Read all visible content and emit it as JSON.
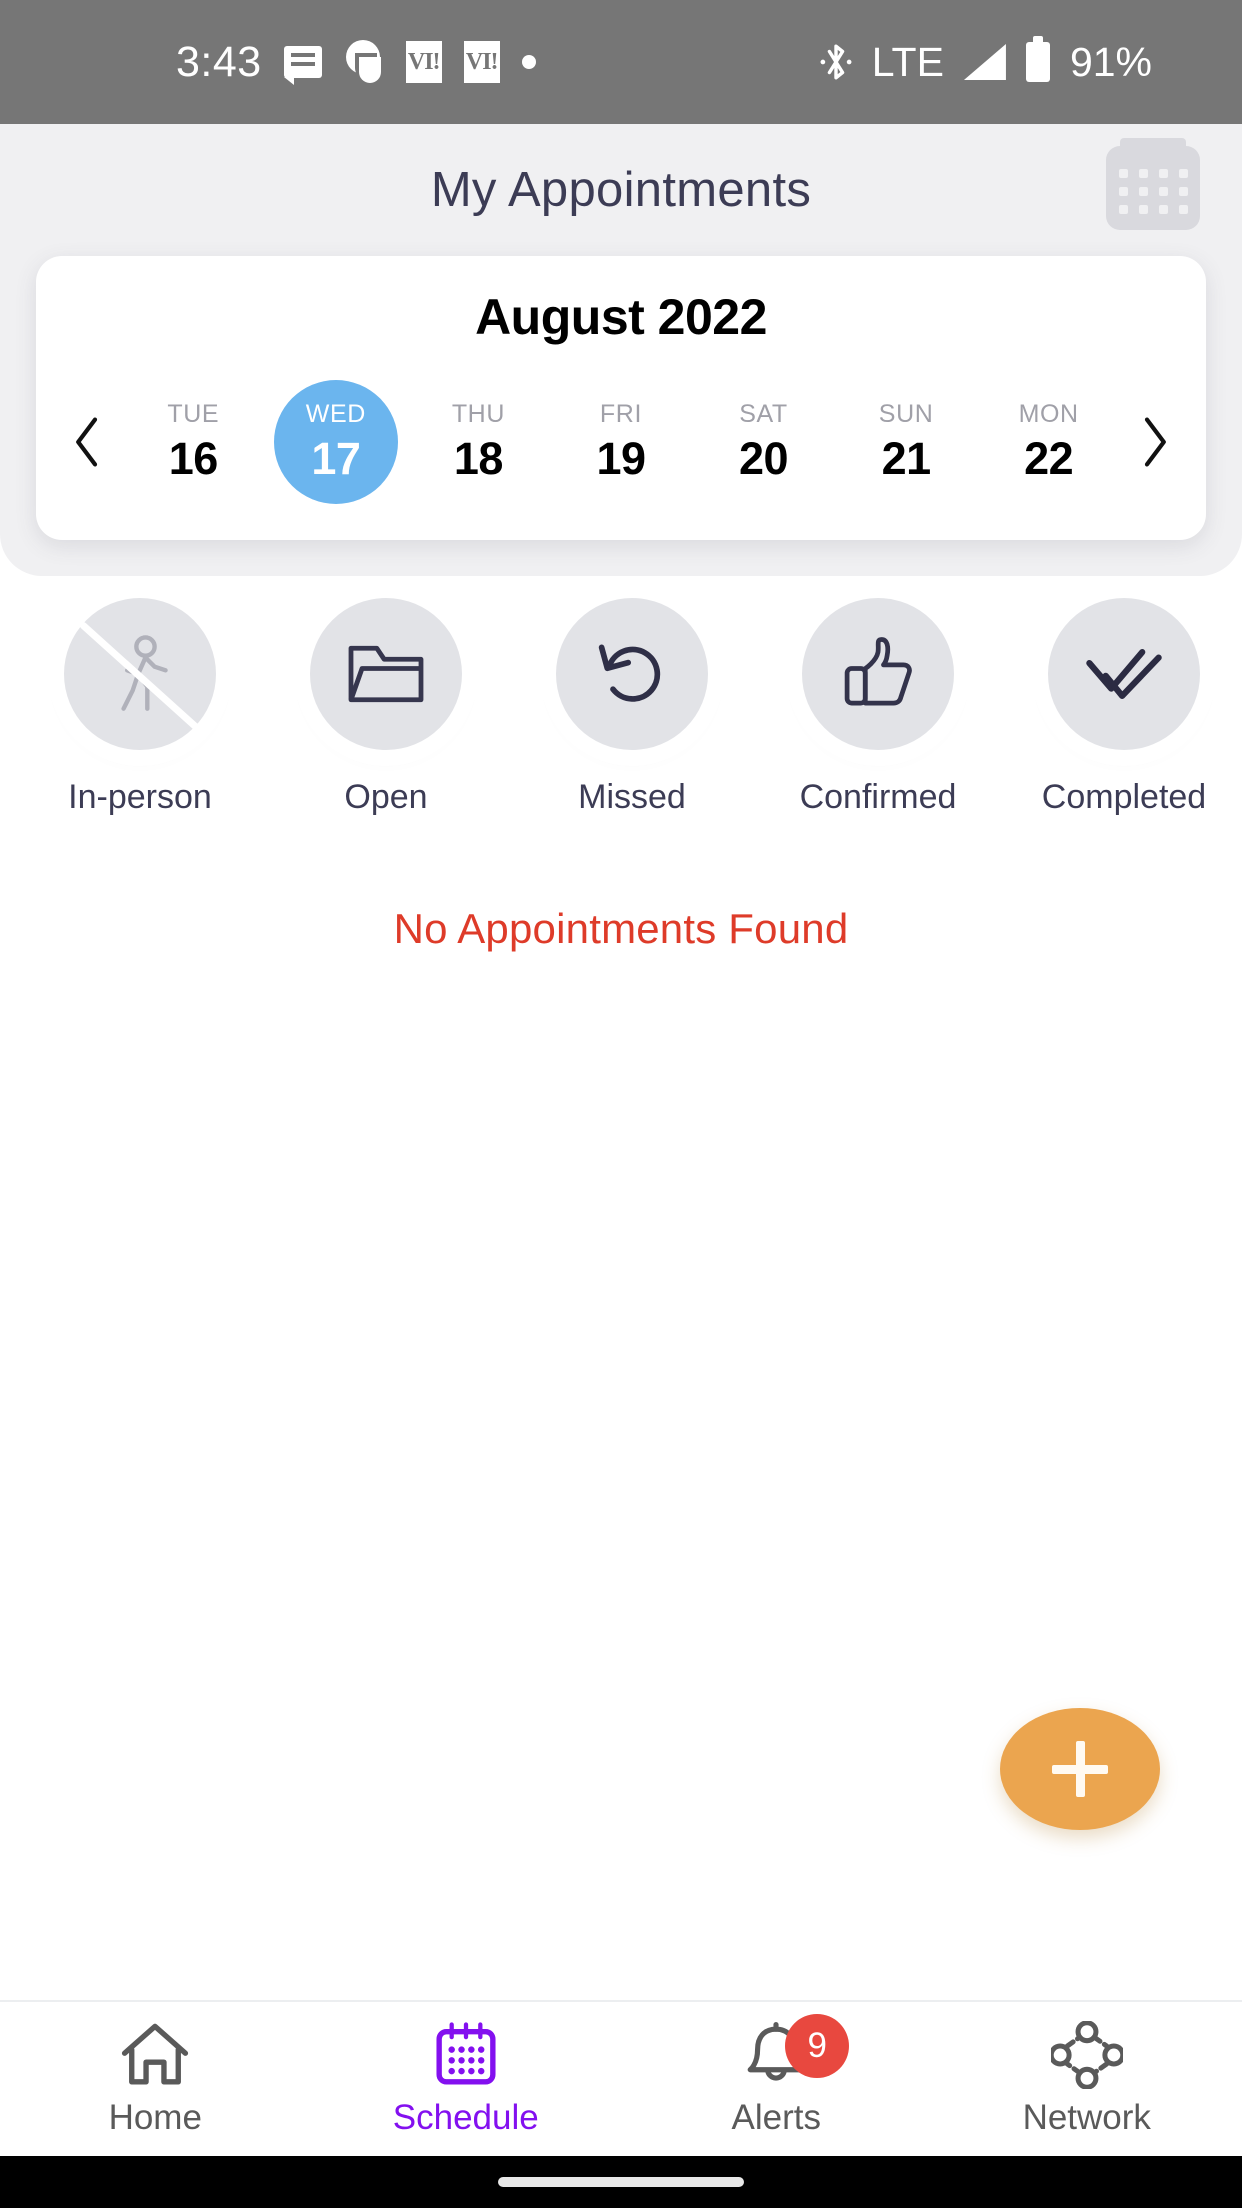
{
  "status_bar": {
    "time": "3:43",
    "icons_left": [
      "message-icon",
      "app-blob-icon",
      "vi-app-icon",
      "vi-app-icon",
      "dot-icon"
    ],
    "vi_label": "VI!",
    "bluetooth": "bluetooth-icon",
    "network_type": "LTE",
    "signal": "signal-bars-icon",
    "battery_percent": "91%",
    "bg_color": "#767676"
  },
  "header": {
    "title": "My Appointments",
    "title_color": "#3c3c55",
    "panel_color": "#f0f0f2",
    "calendar_button": "calendar-icon"
  },
  "date_card": {
    "month": "August 2022",
    "prev_label": "chevron-left-icon",
    "next_label": "chevron-right-icon",
    "selected_index": 1,
    "selected_color": "#6bb5ee",
    "days": [
      {
        "dow": "TUE",
        "num": "16",
        "selected": false
      },
      {
        "dow": "WED",
        "num": "17",
        "selected": true
      },
      {
        "dow": "THU",
        "num": "18",
        "selected": false
      },
      {
        "dow": "FRI",
        "num": "19",
        "selected": false
      },
      {
        "dow": "SAT",
        "num": "20",
        "selected": false
      },
      {
        "dow": "SUN",
        "num": "21",
        "selected": false
      },
      {
        "dow": "MON",
        "num": "22",
        "selected": false
      }
    ]
  },
  "filters": [
    {
      "label": "In-person",
      "icon": "walking-person-slashed-icon",
      "disabled": true
    },
    {
      "label": "Open",
      "icon": "folder-icon",
      "disabled": false
    },
    {
      "label": "Missed",
      "icon": "undo-arrow-icon",
      "disabled": false
    },
    {
      "label": "Confirmed",
      "icon": "thumbs-up-icon",
      "disabled": false
    },
    {
      "label": "Completed",
      "icon": "double-check-icon",
      "disabled": false
    }
  ],
  "content": {
    "empty_message": "No Appointments Found",
    "empty_message_color": "#de3b29",
    "fab_label": "+",
    "fab_color": "#eba54f"
  },
  "bottom_nav": {
    "active_color": "#8310ef",
    "items": [
      {
        "label": "Home",
        "icon": "home-icon",
        "active": false,
        "badge": null
      },
      {
        "label": "Schedule",
        "icon": "calendar-icon",
        "active": true,
        "badge": null
      },
      {
        "label": "Alerts",
        "icon": "bell-icon",
        "active": false,
        "badge": "9"
      },
      {
        "label": "Network",
        "icon": "network-nodes-icon",
        "active": false,
        "badge": null
      }
    ]
  }
}
